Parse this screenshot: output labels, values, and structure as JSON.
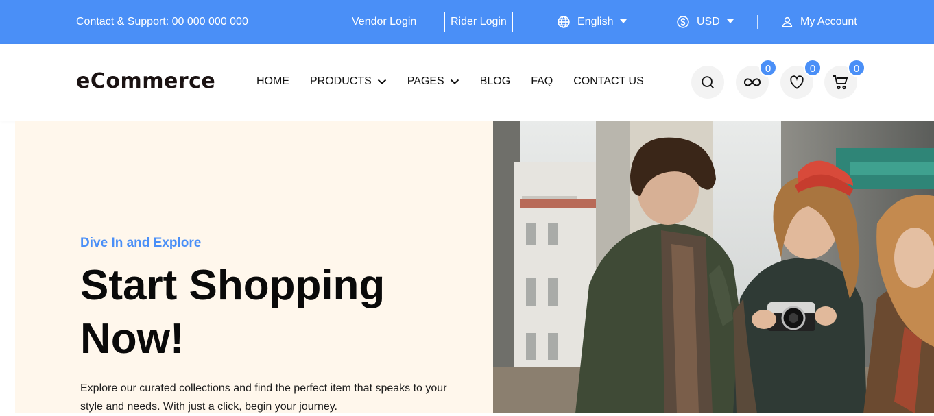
{
  "topbar": {
    "support": "Contact & Support: 00 000 000 000",
    "vendor_login": "Vendor Login",
    "rider_login": "Rider Login",
    "language": "English",
    "currency": "USD",
    "account": "My Account",
    "colors": {
      "bg": "#4a8ff7",
      "text": "#ffffff"
    }
  },
  "header": {
    "logo": "eCommerce",
    "nav": [
      {
        "label": "HOME",
        "dropdown": false
      },
      {
        "label": "PRODUCTS",
        "dropdown": true
      },
      {
        "label": "PAGES",
        "dropdown": true
      },
      {
        "label": "BLOG",
        "dropdown": false
      },
      {
        "label": "FAQ",
        "dropdown": false
      },
      {
        "label": "CONTACT US",
        "dropdown": false
      }
    ],
    "icons": {
      "search": "search-icon",
      "compare": {
        "icon": "infinity-icon",
        "count": "0"
      },
      "wishlist": {
        "icon": "heart-icon",
        "count": "0"
      },
      "cart": {
        "icon": "cart-icon",
        "count": "0"
      }
    }
  },
  "hero": {
    "eyebrow": "Dive In and Explore",
    "headline": "Start Shopping Now!",
    "description": "Explore our curated collections and find the perfect item that speaks to your style and needs. With just a click, begin your journey.",
    "colors": {
      "bg": "#fff7ec",
      "accent": "#4a8ff7"
    }
  }
}
